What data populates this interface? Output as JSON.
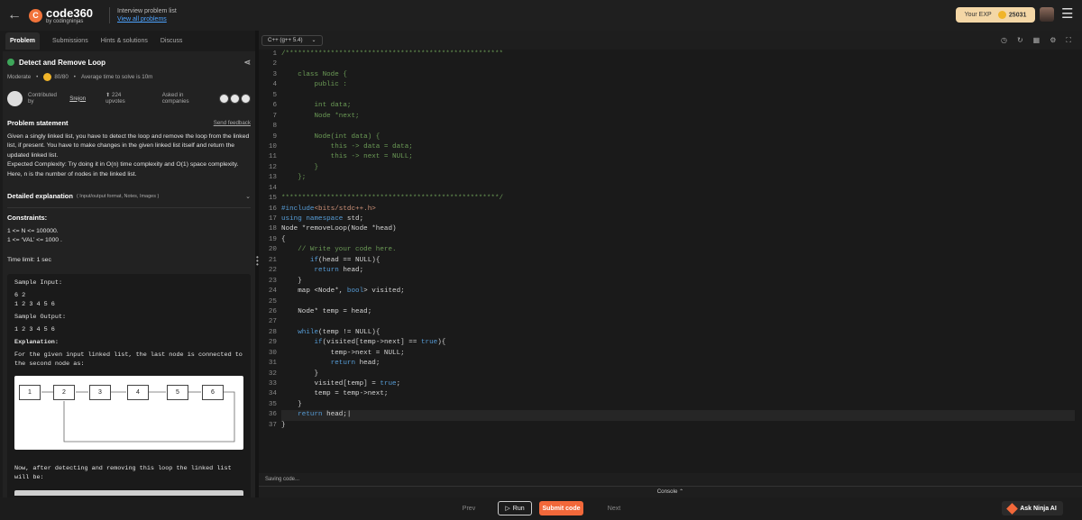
{
  "header": {
    "back_icon": "←",
    "logo_badge": "C",
    "logo_main": "code360",
    "logo_sub": "by codingninjas",
    "crumb_title": "Interview problem list",
    "crumb_link": "View all problems",
    "exp_label": "Your EXP",
    "exp_value": "25031",
    "menu_icon": "☰"
  },
  "tabs": [
    "Problem",
    "Submissions",
    "Hints & solutions",
    "Discuss"
  ],
  "problem": {
    "title": "Detect and Remove Loop",
    "difficulty": "Moderate",
    "score": "80/80",
    "avg_time": "Average time to solve is 10m",
    "contributed_by": "Contributed by",
    "author": "Srejon",
    "upvotes": "224 upvotes",
    "asked_in": "Asked in companies",
    "statement_heading": "Problem statement",
    "send_feedback": "Send feedback",
    "statement": "Given a singly linked list, you have to detect the loop and remove the loop from the linked list, if present. You have to make changes in the given linked list itself and return the updated linked list.",
    "complexity": "Expected Complexity: Try doing it in O(n) time complexity and O(1) space complexity. Here, n is the number of nodes in the linked list.",
    "detailed": "Detailed explanation",
    "detailed_sub": "( Input/output format, Notes, Images )",
    "constraints_heading": "Constraints:",
    "constraint1": "1 <= N <= 100000.",
    "constraint2": "1 <= ‘VAL’ <= 1000 .",
    "time_limit": "Time limit: 1 sec",
    "sample_input_label": "Sample Input:",
    "sample_input_l1": "6 2",
    "sample_input_l2": "1 2 3 4 5 6",
    "sample_output_label": "Sample Output:",
    "sample_output": "1 2 3 4 5 6",
    "explanation_label": "Explanation:",
    "explanation": "For the given input linked list, the last node is connected to the second node as:",
    "diagram_nodes": [
      "1",
      "2",
      "3",
      "4",
      "5",
      "6"
    ],
    "after_text": "Now, after detecting and removing this loop the linked list will be:"
  },
  "editor": {
    "language": "C++ (g++ 5.4)",
    "status": "Saving code...",
    "console": "Console",
    "line_numbers": [
      "1",
      "2",
      "3",
      "4",
      "5",
      "6",
      "7",
      "8",
      "9",
      "10",
      "11",
      "12",
      "13",
      "14",
      "15",
      "16",
      "17",
      "18",
      "19",
      "20",
      "21",
      "22",
      "23",
      "24",
      "25",
      "26",
      "27",
      "28",
      "29",
      "30",
      "31",
      "32",
      "33",
      "34",
      "35",
      "36",
      "37"
    ]
  },
  "footer": {
    "prev": "Prev",
    "run": "Run",
    "submit": "Submit code",
    "next": "Next",
    "ai": "Ask Ninja AI"
  },
  "colors": {
    "accent": "#f2683a",
    "success": "#3ea65a",
    "link": "#4da3ff"
  }
}
